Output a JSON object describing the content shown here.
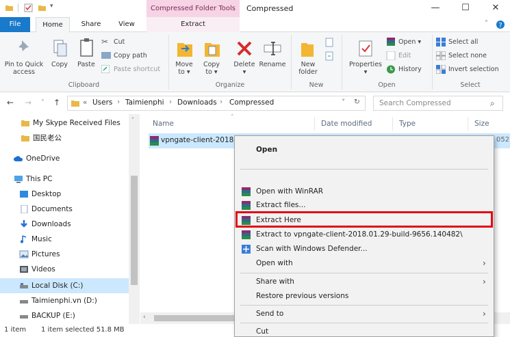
{
  "titlebar": {
    "context_tab_header": "Compressed Folder Tools",
    "window_title": "Compressed",
    "minimize": "—",
    "maximize": "☐",
    "close": "✕"
  },
  "tabs": {
    "file": "File",
    "home": "Home",
    "share": "Share",
    "view": "View",
    "extract": "Extract"
  },
  "ribbon": {
    "clipboard": {
      "pin_to_quick_access": [
        "Pin to Quick",
        "access"
      ],
      "copy": "Copy",
      "paste": "Paste",
      "cut": "Cut",
      "copy_path": "Copy path",
      "paste_shortcut": "Paste shortcut",
      "group_label": "Clipboard"
    },
    "organize": {
      "move_to": [
        "Move",
        "to ▾"
      ],
      "copy_to": [
        "Copy",
        "to ▾"
      ],
      "delete": [
        "Delete",
        "▾"
      ],
      "rename": "Rename",
      "group_label": "Organize"
    },
    "new": {
      "new_folder": [
        "New",
        "folder"
      ],
      "group_label": "New"
    },
    "open": {
      "properties": [
        "Properties",
        "▾"
      ],
      "open": "Open ▾",
      "edit": "Edit",
      "history": "History",
      "group_label": "Open"
    },
    "select": {
      "select_all": "Select all",
      "select_none": "Select none",
      "invert_selection": "Invert selection",
      "group_label": "Select"
    }
  },
  "address": {
    "back": "←",
    "forward": "→",
    "recent": "˅",
    "up": "↑",
    "prefix": "«",
    "path": [
      "Users",
      "Taimienphi",
      "Downloads",
      "Compressed"
    ],
    "separator": "›",
    "dropdown": "˅",
    "refresh": "↻",
    "search_placeholder": "Search Compressed",
    "search_icon_glyph": "⌕"
  },
  "navpane": {
    "items": [
      {
        "label": "My Skype Received Files",
        "icon": "folder-icon"
      },
      {
        "label": "国民老公",
        "icon": "folder-icon"
      },
      {
        "label": "OneDrive",
        "icon": "cloud-icon"
      },
      {
        "label": "This PC",
        "icon": "pc-icon"
      },
      {
        "label": "Desktop",
        "icon": "desktop-icon"
      },
      {
        "label": "Documents",
        "icon": "documents-icon"
      },
      {
        "label": "Downloads",
        "icon": "downloads-icon"
      },
      {
        "label": "Music",
        "icon": "music-icon"
      },
      {
        "label": "Pictures",
        "icon": "pictures-icon"
      },
      {
        "label": "Videos",
        "icon": "videos-icon"
      },
      {
        "label": "Local Disk (C:)",
        "icon": "drive-icon"
      },
      {
        "label": "Taimienphi.vn (D:)",
        "icon": "drive-icon"
      },
      {
        "label": "BACKUP (E:)",
        "icon": "drive-icon"
      }
    ]
  },
  "filelist": {
    "columns": {
      "name": "Name",
      "date_modified": "Date modified",
      "type": "Type",
      "size": "Size"
    },
    "sort_indicator": "˄",
    "file_name": "vpngate-client-2018",
    "size_fragment": "052"
  },
  "status": {
    "item_count": "1 item",
    "selection": "1 item selected  51.8 MB"
  },
  "context_menu": {
    "items": [
      {
        "label": "Open",
        "bold": true
      },
      {
        "label": "Open with WinRAR"
      },
      {
        "label": "Extract files..."
      },
      {
        "label": "Extract Here"
      },
      {
        "label": "Extract to vpngate-client-2018.01.29-build-9656.140482\\"
      },
      {
        "label": "Scan with Windows Defender..."
      },
      {
        "label": "Open with"
      },
      {
        "label": "Share with"
      },
      {
        "label": "Restore previous versions"
      },
      {
        "label": "Send to"
      },
      {
        "label": "Cut"
      }
    ],
    "submenu_arrow": "›"
  },
  "colors": {
    "file_tab": "#1979ca",
    "context_tab": "#f6d3e5",
    "selection": "#cce8ff",
    "highlight_box": "#e30613"
  }
}
